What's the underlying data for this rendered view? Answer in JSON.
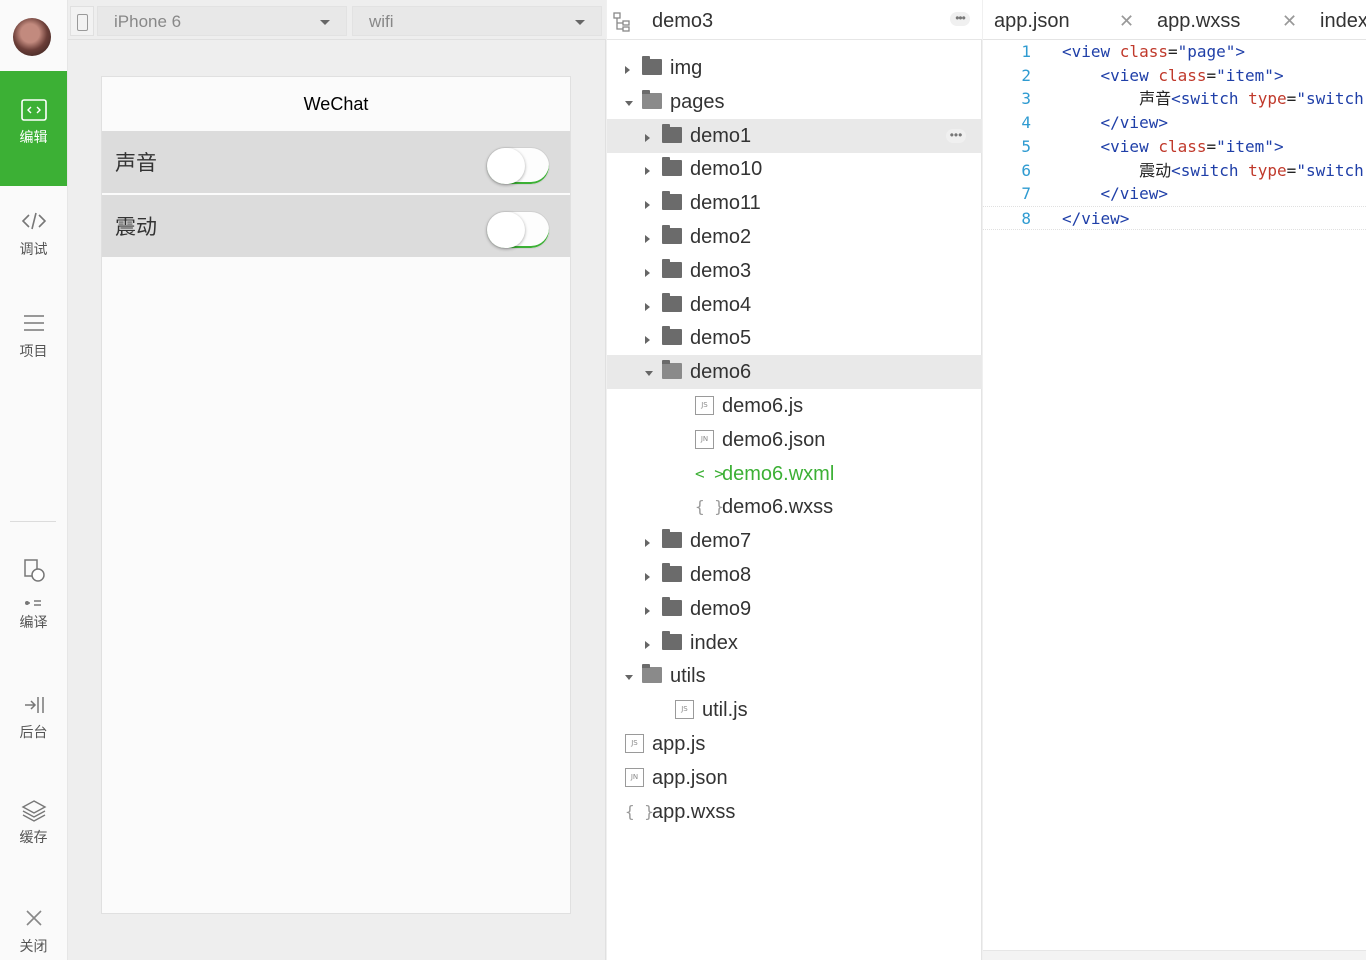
{
  "nav": {
    "items": [
      {
        "label": "编辑",
        "icon": "code-editor-icon"
      },
      {
        "label": "调试",
        "icon": "debug-icon"
      },
      {
        "label": "项目",
        "icon": "project-menu-icon"
      },
      {
        "label": "编译",
        "icon": "compile-icon"
      },
      {
        "label": "后台",
        "icon": "background-icon"
      },
      {
        "label": "缓存",
        "icon": "cache-layers-icon"
      },
      {
        "label": "关闭",
        "icon": "close-icon"
      }
    ],
    "active_color": "#3cb035"
  },
  "simulator": {
    "device": "iPhone 6",
    "network": "wifi",
    "page_title": "WeChat",
    "rows": [
      {
        "label": "声音",
        "switch_on": false
      },
      {
        "label": "震动",
        "switch_on": false
      }
    ]
  },
  "tree": {
    "project": "demo3",
    "items": [
      {
        "name": "img",
        "kind": "folder",
        "expanded": false
      },
      {
        "name": "pages",
        "kind": "folder",
        "expanded": true
      },
      {
        "name": "demo1",
        "kind": "folder",
        "expanded": false
      },
      {
        "name": "demo10",
        "kind": "folder",
        "expanded": false
      },
      {
        "name": "demo11",
        "kind": "folder",
        "expanded": false
      },
      {
        "name": "demo2",
        "kind": "folder",
        "expanded": false
      },
      {
        "name": "demo3",
        "kind": "folder",
        "expanded": false
      },
      {
        "name": "demo4",
        "kind": "folder",
        "expanded": false
      },
      {
        "name": "demo5",
        "kind": "folder",
        "expanded": false
      },
      {
        "name": "demo6",
        "kind": "folder",
        "expanded": true
      },
      {
        "name": "demo6.js",
        "kind": "file",
        "badge": "JS"
      },
      {
        "name": "demo6.json",
        "kind": "file",
        "badge": "JN"
      },
      {
        "name": "demo6.wxml",
        "kind": "wxml",
        "badge": "< >",
        "active": true
      },
      {
        "name": "demo6.wxss",
        "kind": "wxss",
        "badge": "{ }"
      },
      {
        "name": "demo7",
        "kind": "folder",
        "expanded": false
      },
      {
        "name": "demo8",
        "kind": "folder",
        "expanded": false
      },
      {
        "name": "demo9",
        "kind": "folder",
        "expanded": false
      },
      {
        "name": "index",
        "kind": "folder",
        "expanded": false
      },
      {
        "name": "utils",
        "kind": "folder",
        "expanded": true
      },
      {
        "name": "util.js",
        "kind": "file",
        "badge": "JS"
      },
      {
        "name": "app.js",
        "kind": "file",
        "badge": "JS"
      },
      {
        "name": "app.json",
        "kind": "file",
        "badge": "JN"
      },
      {
        "name": "app.wxss",
        "kind": "wxss",
        "badge": "{ }"
      }
    ]
  },
  "editor": {
    "tabs": [
      "app.json",
      "app.wxss",
      "index"
    ],
    "lines": [
      {
        "n": "1",
        "indent": "",
        "parts": [
          [
            "tag",
            "<view "
          ],
          [
            "attr",
            "class"
          ],
          [
            "txt",
            "="
          ],
          [
            "str",
            "\"page\""
          ],
          [
            "tag",
            ">"
          ]
        ]
      },
      {
        "n": "2",
        "indent": "    ",
        "parts": [
          [
            "tag",
            "<view "
          ],
          [
            "attr",
            "class"
          ],
          [
            "txt",
            "="
          ],
          [
            "str",
            "\"item\""
          ],
          [
            "tag",
            ">"
          ]
        ]
      },
      {
        "n": "3",
        "indent": "        ",
        "parts": [
          [
            "txt",
            "声音"
          ],
          [
            "tag",
            "<switch "
          ],
          [
            "attr",
            "type"
          ],
          [
            "txt",
            "="
          ],
          [
            "str",
            "\"switch"
          ]
        ]
      },
      {
        "n": "4",
        "indent": "    ",
        "parts": [
          [
            "tag",
            "</view>"
          ]
        ]
      },
      {
        "n": "5",
        "indent": "    ",
        "parts": [
          [
            "tag",
            "<view "
          ],
          [
            "attr",
            "class"
          ],
          [
            "txt",
            "="
          ],
          [
            "str",
            "\"item\""
          ],
          [
            "tag",
            ">"
          ]
        ]
      },
      {
        "n": "6",
        "indent": "        ",
        "parts": [
          [
            "txt",
            "震动"
          ],
          [
            "tag",
            "<switch "
          ],
          [
            "attr",
            "type"
          ],
          [
            "txt",
            "="
          ],
          [
            "str",
            "\"switch"
          ]
        ]
      },
      {
        "n": "7",
        "indent": "    ",
        "parts": [
          [
            "tag",
            "</view>"
          ]
        ]
      },
      {
        "n": "8",
        "indent": "",
        "parts": [
          [
            "tag",
            "</view>"
          ]
        ]
      }
    ]
  }
}
